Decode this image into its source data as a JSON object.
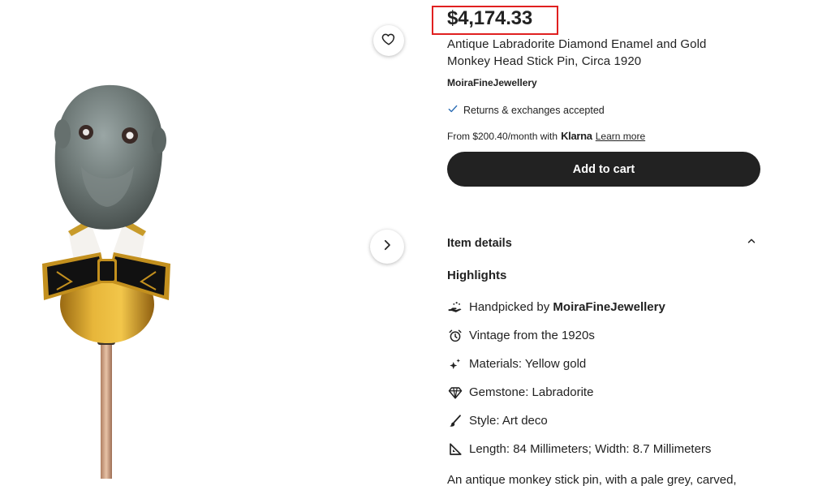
{
  "listing": {
    "price": "$4,174.33",
    "title_line1": "Antique Labradorite Diamond Enamel and Gold",
    "title_line2": "Monkey Head Stick Pin, Circa 1920",
    "shop_name": "MoiraFineJewellery",
    "returns_text": "Returns & exchanges accepted",
    "klarna_prefix": "From $200.40/month with",
    "klarna_brand": "Klarna",
    "learn_more": "Learn more",
    "add_to_cart": "Add to cart"
  },
  "details": {
    "heading": "Item details",
    "highlights_heading": "Highlights",
    "handpicked_prefix": "Handpicked by",
    "handpicked_shop": "MoiraFineJewellery",
    "vintage": "Vintage from the 1920s",
    "materials": "Materials: Yellow gold",
    "gemstone": "Gemstone: Labradorite",
    "style": "Style: Art deco",
    "dimensions": "Length: 84 Millimeters; Width: 8.7 Millimeters",
    "description": "An antique monkey stick pin, with a pale grey, carved,"
  },
  "icons": {
    "favorite": "heart-icon",
    "next": "chevron-right-icon",
    "collapse": "chevron-up-icon",
    "returns": "check-icon",
    "handpicked": "hand-icon",
    "vintage": "alarm-clock-icon",
    "materials": "sparkle-icon",
    "gemstone": "gem-icon",
    "style": "brush-icon",
    "dimensions": "ruler-icon"
  },
  "colors": {
    "primary_button": "#222222",
    "price_highlight_border": "#e02020",
    "check": "#2f6fb5"
  }
}
